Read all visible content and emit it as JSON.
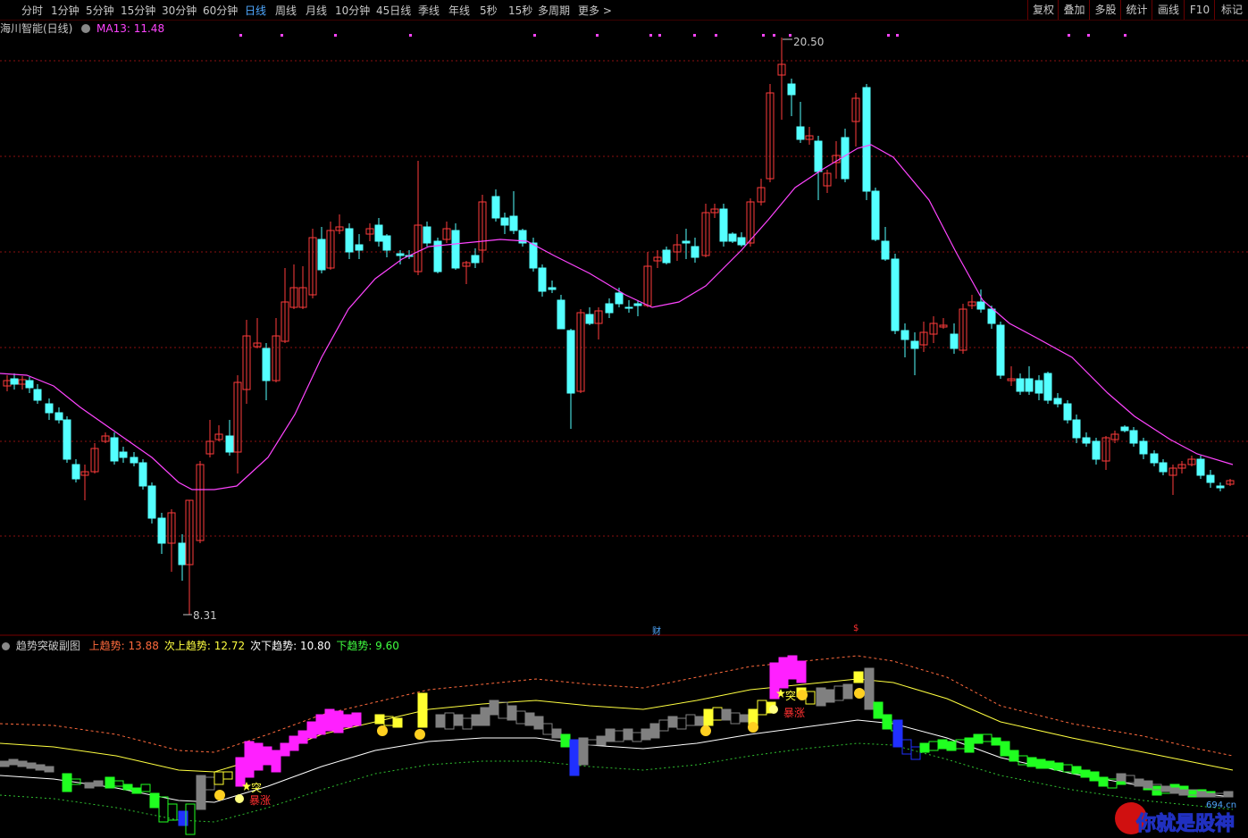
{
  "toolbar": {
    "periods": [
      "分时",
      "1分钟",
      "5分钟",
      "15分钟",
      "30分钟",
      "60分钟",
      "日线",
      "周线",
      "月线",
      "10分钟",
      "45日线",
      "季线",
      "年线",
      "5秒",
      "15秒",
      "多周期",
      "更多 >"
    ],
    "active_index": 6,
    "right_buttons": [
      "复权",
      "叠加",
      "多股",
      "统计",
      "画线",
      "F10",
      "标记"
    ]
  },
  "main_panel": {
    "title": "海川智能(日线)",
    "ma_label": "MA13: 11.48",
    "high_label": "20.50",
    "low_label": "8.31",
    "marker_cai": "财",
    "marker_s": "$"
  },
  "sub_panel": {
    "title": "趋势突破副图",
    "indicators": [
      {
        "label": "上趋势:",
        "value": "13.88",
        "color": "#ff6a3d"
      },
      {
        "label": "次上趋势:",
        "value": "12.72",
        "color": "#ffff40"
      },
      {
        "label": "次下趋势:",
        "value": "10.80",
        "color": "#ffffff"
      },
      {
        "label": "下趋势:",
        "value": "9.60",
        "color": "#40ff40"
      }
    ],
    "tag_tu": "突",
    "tag_baozhang": "暴涨",
    "tag_tu2": "突",
    "tag_baozhang2": "暴涨"
  },
  "watermark": {
    "text": "你就是股神",
    "site": "694.cn"
  },
  "colors": {
    "up": "#ff3b3b",
    "down": "#54ffff",
    "ma": "#ff44ff",
    "grid": "#8b1010",
    "magenta_bar": "#ff20ff",
    "yellow_bar": "#ffff30",
    "gray_bar": "#808080",
    "green_bar": "#20ff20",
    "blue_bar": "#2030ff"
  }
}
